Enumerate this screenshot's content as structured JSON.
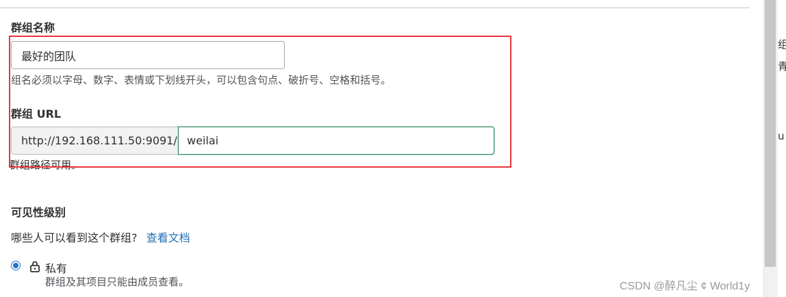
{
  "group_name": {
    "label": "群组名称",
    "value": "最好的团队",
    "help": "组名必须以字母、数字、表情或下划线开头，可以包含句点、破折号、空格和括号。"
  },
  "group_url": {
    "label": "群组 URL",
    "prefix": "http://192.168.111.50:9091/",
    "value": "weilai",
    "status": "群组路径可用。"
  },
  "visibility": {
    "label": "可见性级别",
    "question": "哪些人可以看到这个群组?",
    "doc_link": "查看文档",
    "options": [
      {
        "label": "私有",
        "description": "群组及其项目只能由成员查看。",
        "selected": true
      }
    ]
  },
  "side_fragments": [
    "组",
    "青",
    "u"
  ],
  "watermark": "CSDN @醉凡尘 ¢  World1y",
  "colors": {
    "accent": "#1f75cb",
    "focus_border": "#2f8a5f",
    "highlight": "#e8343a",
    "link": "#1f6fb3"
  }
}
